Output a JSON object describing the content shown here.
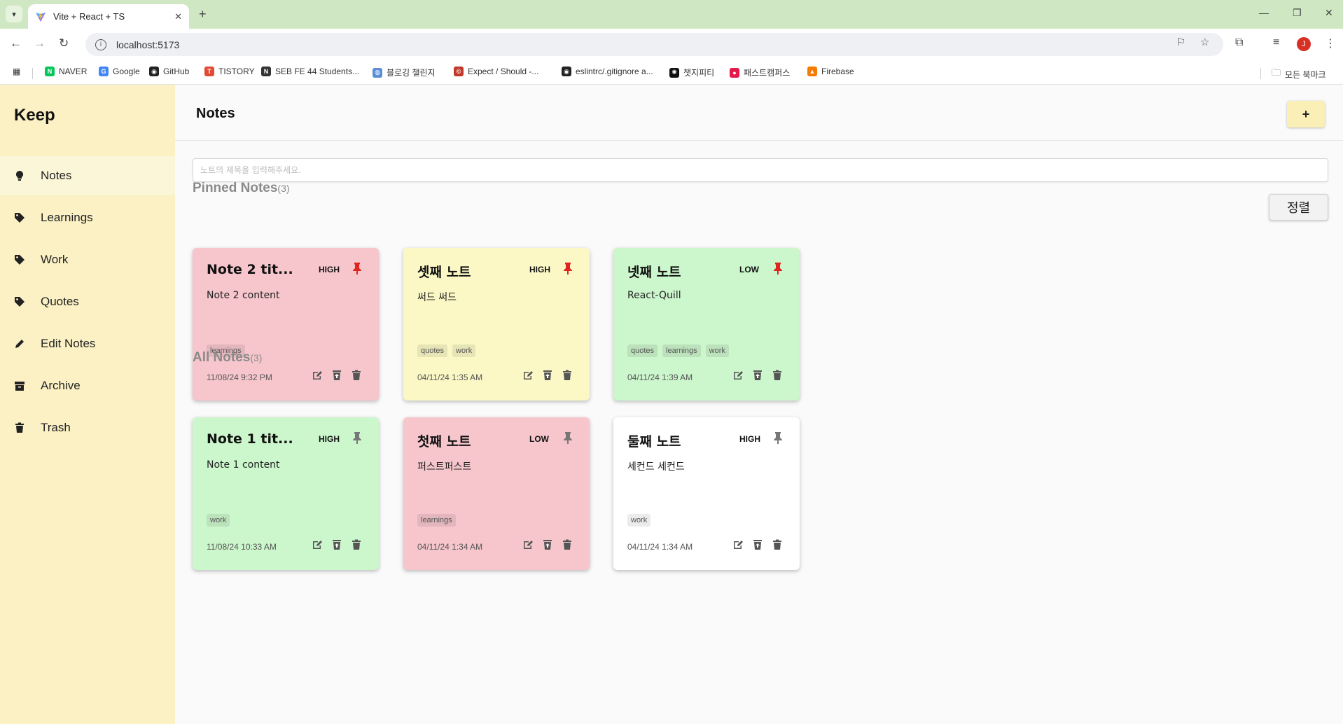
{
  "browser": {
    "tab_title": "Vite + React + TS",
    "url": "localhost:5173",
    "profile_initial": "J",
    "bookmarks": [
      {
        "label": "NAVER",
        "color": "#03c75a",
        "glyph": "N"
      },
      {
        "label": "Google",
        "color": "#4285f4",
        "glyph": "G"
      },
      {
        "label": "GitHub",
        "color": "#222222",
        "glyph": "◉"
      },
      {
        "label": "TISTORY",
        "color": "#e34a33",
        "glyph": "T"
      },
      {
        "label": "SEB FE 44 Students...",
        "color": "#333333",
        "glyph": "N"
      },
      {
        "label": "블로깅 챌린지",
        "color": "#5a8fd6",
        "glyph": "◍"
      },
      {
        "label": "Expect / Should -...",
        "color": "#c0392b",
        "glyph": "©"
      },
      {
        "label": "eslintrc/.gitignore a...",
        "color": "#222222",
        "glyph": "◉"
      },
      {
        "label": "챗지피티",
        "color": "#111111",
        "glyph": "✺"
      },
      {
        "label": "패스트캠퍼스",
        "color": "#e6194b",
        "glyph": "●"
      },
      {
        "label": "Firebase",
        "color": "#f57c00",
        "glyph": "▲"
      }
    ],
    "all_bookmarks_label": "모든 북마크"
  },
  "sidebar": {
    "logo": "Keep",
    "items": [
      {
        "label": "Notes",
        "icon": "lightbulb-icon"
      },
      {
        "label": "Learnings",
        "icon": "tag-icon"
      },
      {
        "label": "Work",
        "icon": "tag-icon"
      },
      {
        "label": "Quotes",
        "icon": "tag-icon"
      },
      {
        "label": "Edit Notes",
        "icon": "pencil-icon"
      },
      {
        "label": "Archive",
        "icon": "archive-icon"
      },
      {
        "label": "Trash",
        "icon": "trash-icon"
      }
    ]
  },
  "header": {
    "title": "Notes",
    "add_label": "+"
  },
  "search": {
    "placeholder": "노트의 제목을 입력해주세요."
  },
  "sort_label": "정렬",
  "pinned": {
    "title": "Pinned Notes",
    "count": "(3)",
    "notes": [
      {
        "title": "Note 2 tit...",
        "priority": "HIGH",
        "content": "Note 2 content",
        "tags": [
          "learnings"
        ],
        "date": "11/08/24 9:32 PM",
        "color": "#f6c6cc",
        "pinned": true
      },
      {
        "title": "셋째 노트",
        "priority": "HIGH",
        "content": "써드 써드",
        "tags": [
          "quotes",
          "work"
        ],
        "date": "04/11/24 1:35 AM",
        "color": "#fbf8c6",
        "pinned": true
      },
      {
        "title": "넷째 노트",
        "priority": "LOW",
        "content": "React-Quill",
        "tags": [
          "quotes",
          "learnings",
          "work"
        ],
        "date": "04/11/24 1:39 AM",
        "color": "#ccf6cc",
        "pinned": true
      }
    ]
  },
  "all": {
    "title": "All Notes",
    "count": "(3)",
    "notes": [
      {
        "title": "Note 1 tit...",
        "priority": "HIGH",
        "content": "Note 1 content",
        "tags": [
          "work"
        ],
        "date": "11/08/24 10:33 AM",
        "color": "#ccf6cc",
        "pinned": false
      },
      {
        "title": "첫째 노트",
        "priority": "LOW",
        "content": "퍼스트퍼스트",
        "tags": [
          "learnings"
        ],
        "date": "04/11/24 1:34 AM",
        "color": "#f6c6cc",
        "pinned": false
      },
      {
        "title": "둘째 노트",
        "priority": "HIGH",
        "content": "세컨드 세컨드",
        "tags": [
          "work"
        ],
        "date": "04/11/24 1:34 AM",
        "color": "#ffffff",
        "pinned": false
      }
    ]
  },
  "colors": {
    "sidebar_bg": "#fbf1c4",
    "pin_active": "#e0241e",
    "pin_inactive": "#777777"
  }
}
